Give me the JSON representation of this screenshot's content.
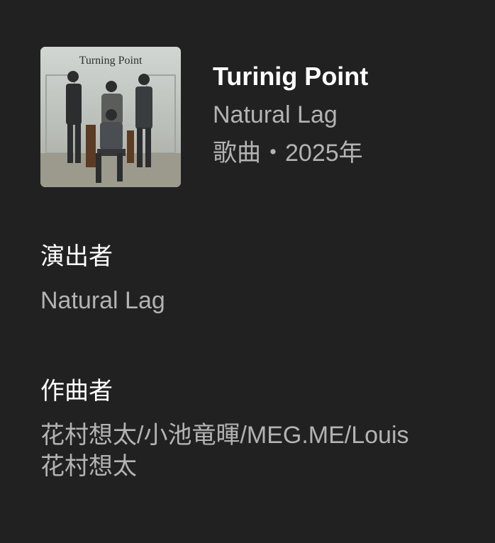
{
  "song": {
    "title": "Turinig Point",
    "artist": "Natural Lag",
    "type_year": "歌曲・2025年",
    "cover_text": "Turning Point"
  },
  "performer": {
    "label": "演出者",
    "value": "Natural Lag"
  },
  "composer": {
    "label": "作曲者",
    "lines": [
      "花村想太/小池竜暉/MEG.ME/Louis",
      "花村想太"
    ]
  }
}
